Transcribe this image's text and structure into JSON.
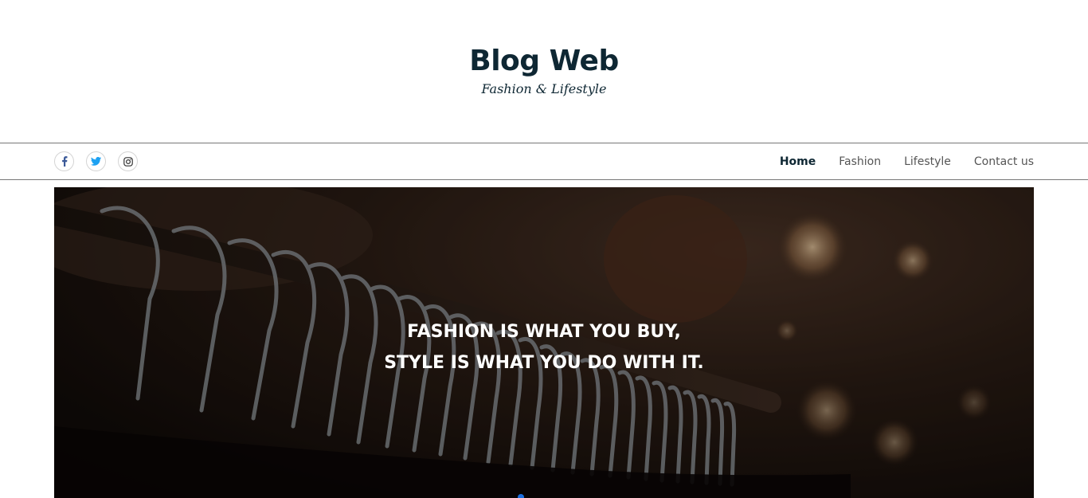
{
  "header": {
    "title": "Blog Web",
    "tagline": "Fashion & Lifestyle"
  },
  "social": [
    {
      "name": "facebook",
      "icon": "facebook-icon",
      "color": "#3b5998"
    },
    {
      "name": "twitter",
      "icon": "twitter-icon",
      "color": "#1da1f2"
    },
    {
      "name": "instagram",
      "icon": "instagram-icon",
      "color": "#333333"
    }
  ],
  "nav": {
    "items": [
      {
        "label": "Home",
        "active": true
      },
      {
        "label": "Fashion",
        "active": false
      },
      {
        "label": "Lifestyle",
        "active": false
      },
      {
        "label": "Contact us",
        "active": false
      }
    ]
  },
  "hero": {
    "quote_line1": "FASHION IS WHAT YOU BUY,",
    "quote_line2": "STYLE IS WHAT YOU DO WITH IT.",
    "background": "clothes-hangers-on-rack-photo"
  },
  "colors": {
    "brand": "#0e2733",
    "nav_text": "#555555",
    "carousel_active": "#1a6ee0"
  }
}
